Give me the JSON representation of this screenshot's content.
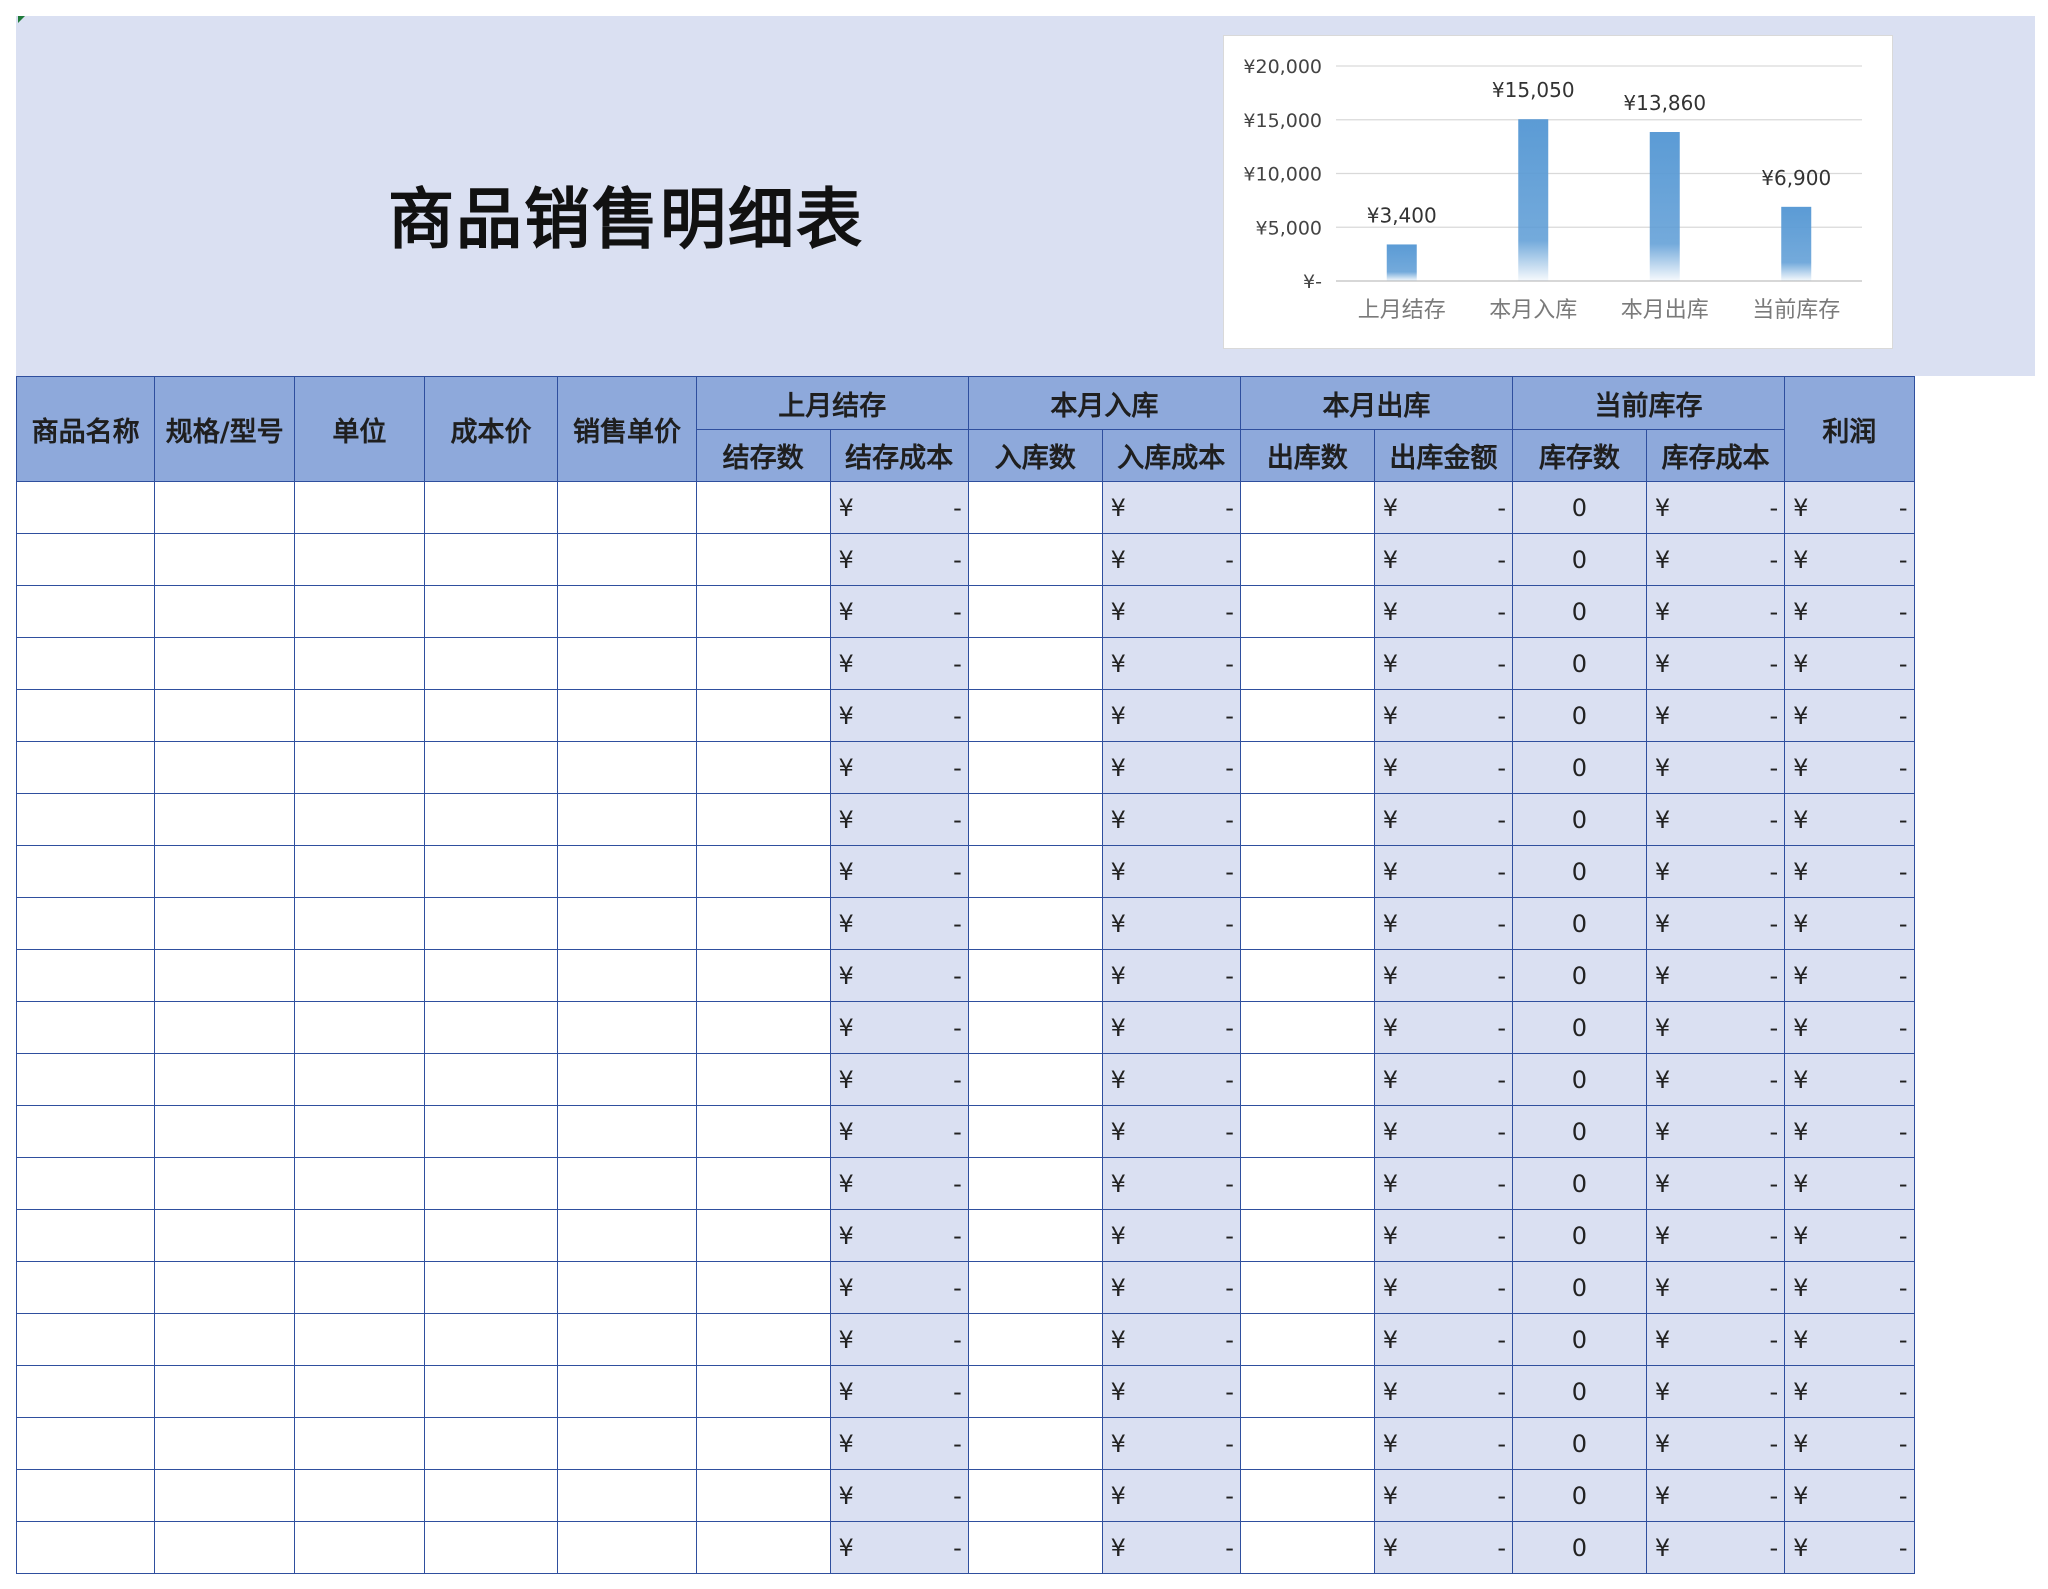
{
  "title": "商品销售明细表",
  "chart_data": {
    "type": "bar",
    "categories": [
      "上月结存",
      "本月入库",
      "本月出库",
      "当前库存"
    ],
    "values": [
      3400,
      15050,
      13860,
      6900
    ],
    "data_labels": [
      "¥3,400",
      "¥15,050",
      "¥13,860",
      "¥6,900"
    ],
    "y_ticks": [
      0,
      5000,
      10000,
      15000,
      20000
    ],
    "y_tick_labels": [
      "¥-",
      "¥5,000",
      "¥10,000",
      "¥15,000",
      "¥20,000"
    ],
    "ylim": [
      0,
      20000
    ],
    "grid": true,
    "bar_color": "#5b9bd5"
  },
  "table": {
    "headers": {
      "product_name": "商品名称",
      "spec": "规格/型号",
      "unit": "单位",
      "cost_price": "成本价",
      "sale_price": "销售单价",
      "last_month": "上月结存",
      "this_in": "本月入库",
      "this_out": "本月出库",
      "current": "当前库存",
      "profit": "利润",
      "sub": [
        "结存数",
        "结存成本",
        "入库数",
        "入库成本",
        "出库数",
        "出库金额",
        "库存数",
        "库存成本"
      ]
    },
    "row_count": 21,
    "currency_symbol": "¥",
    "dash": "-",
    "zero": "0"
  },
  "colors": {
    "banner": "#dae0f2",
    "header": "#8ea9db",
    "border": "#2f4f9e"
  }
}
